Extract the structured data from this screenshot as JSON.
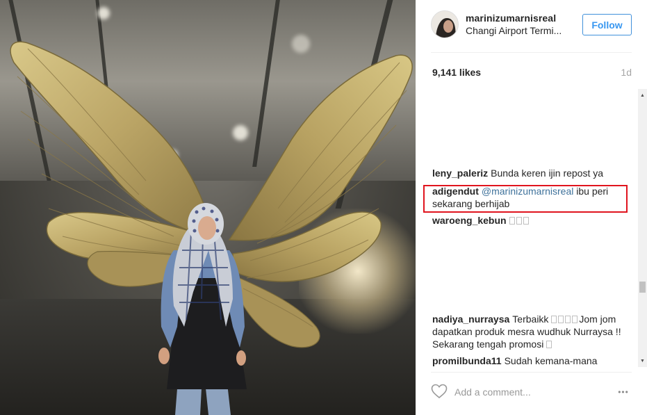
{
  "post": {
    "username": "marinizumarnisreal",
    "location": "Changi Airport Termi...",
    "follow_label": "Follow",
    "likes": "9,141 likes",
    "time_ago": "1d"
  },
  "comments": [
    {
      "author": "leny_paleriz",
      "mention": "",
      "text": "Bunda keren ijin repost ya",
      "glyphs": 0,
      "tail": ""
    },
    {
      "author": "adigendut",
      "mention": "@marinizumarnisreal",
      "text": "ibu peri sekarang berhijab",
      "glyphs": 0,
      "tail": ""
    },
    {
      "author": "waroeng_kebun",
      "mention": "",
      "text": "",
      "glyphs": 3,
      "tail": ""
    },
    {
      "author": "nadiya_nurraysa",
      "mention": "",
      "text": "Terbaikk",
      "glyphs": 4,
      "tail": "Jom jom dapatkan produk mesra wudhuk Nurraysa !! Sekarang tengah promosi"
    },
    {
      "author": "promilbunda11",
      "mention": "",
      "text": "Sudah kemana-mana",
      "glyphs": 0,
      "tail": ""
    }
  ],
  "footer": {
    "comment_placeholder": "Add a comment...",
    "more_label": "•••"
  },
  "icons": {
    "heart": "heart-outline-icon",
    "more": "more-options-icon",
    "scroll_up": "scroll-up-arrow-icon",
    "scroll_down": "scroll-down-arrow-icon"
  },
  "colors": {
    "follow_blue": "#3897f0",
    "mention_blue": "#3f729b",
    "highlight_red": "#e0141e",
    "muted_gray": "#999999"
  }
}
